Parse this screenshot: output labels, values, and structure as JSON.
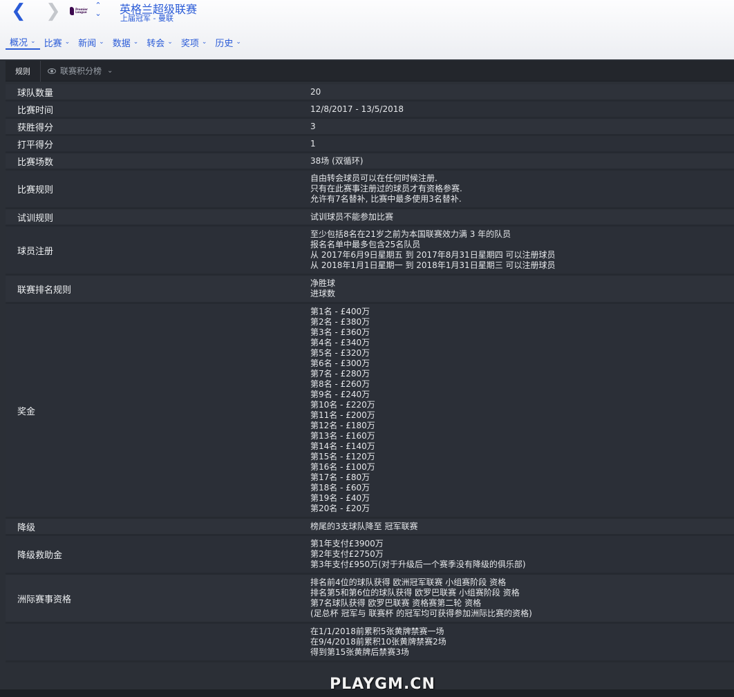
{
  "header": {
    "title": "英格兰超级联赛",
    "subtitle": "上届冠军 - 曼联",
    "logo_text": "Premier League",
    "back_icon": "chevron-left-icon",
    "forward_icon": "chevron-right-icon"
  },
  "tabs": [
    {
      "label": "概况"
    },
    {
      "label": "比赛"
    },
    {
      "label": "新闻"
    },
    {
      "label": "数据"
    },
    {
      "label": "转会"
    },
    {
      "label": "奖项"
    },
    {
      "label": "历史"
    }
  ],
  "toolbar": {
    "rules_label": "规则",
    "standings_label": "联赛积分榜"
  },
  "rows": [
    {
      "label": "球队数量",
      "lines": [
        "20"
      ]
    },
    {
      "label": "比赛时间",
      "lines": [
        "12/8/2017 - 13/5/2018"
      ]
    },
    {
      "label": "获胜得分",
      "lines": [
        "3"
      ]
    },
    {
      "label": "打平得分",
      "lines": [
        "1"
      ]
    },
    {
      "label": "比赛场数",
      "lines": [
        "38场 (双循环)"
      ]
    },
    {
      "label": "比赛规则",
      "lines": [
        "自由转会球员可以在任何时候注册.",
        "只有在此赛事注册过的球员才有资格参赛.",
        "允许有7名替补, 比赛中最多使用3名替补."
      ]
    },
    {
      "label": "试训规则",
      "lines": [
        "试训球员不能参加比赛"
      ]
    },
    {
      "label": "球员注册",
      "lines": [
        "至少包括8名在21岁之前为本国联赛效力满 3 年的队员",
        "报名名单中最多包含25名队员",
        "从 2017年6月9日星期五 到 2017年8月31日星期四 可以注册球员",
        "从 2018年1月1日星期一 到 2018年1月31日星期三 可以注册球员"
      ]
    },
    {
      "label": "联赛排名规则",
      "lines": [
        "净胜球",
        "进球数"
      ]
    },
    {
      "label": "奖金",
      "lines": [
        "第1名 - £400万",
        "第2名 - £380万",
        "第3名 - £360万",
        "第4名 - £340万",
        "第5名 - £320万",
        "第6名 - £300万",
        "第7名 - £280万",
        "第8名 - £260万",
        "第9名 - £240万",
        "第10名 - £220万",
        "第11名 - £200万",
        "第12名 - £180万",
        "第13名 - £160万",
        "第14名 - £140万",
        "第15名 - £120万",
        "第16名 - £100万",
        "第17名 - £80万",
        "第18名 - £60万",
        "第19名 - £40万",
        "第20名 - £20万"
      ]
    },
    {
      "label": "降级",
      "lines": [
        "榜尾的3支球队降至 冠军联赛"
      ]
    },
    {
      "label": "降级救助金",
      "lines": [
        "第1年支付£3900万",
        "第2年支付£2750万",
        "第3年支付£950万(对于升级后一个赛季没有降级的俱乐部)"
      ]
    },
    {
      "label": "洲际赛事资格",
      "lines": [
        "排名前4位的球队获得 欧洲冠军联赛 小组赛阶段 资格",
        "排名第5和第6位的球队获得 欧罗巴联赛 小组赛阶段 资格",
        "第7名球队获得 欧罗巴联赛 资格赛第二轮 资格",
        "(足总杯 冠军与 联赛杯 的冠军均可获得参加洲际比赛的资格)"
      ]
    },
    {
      "label": "",
      "lines": [
        "在1/1/2018前累积5张黄牌禁赛一场",
        "在9/4/2018前累积10张黄牌禁赛2场",
        "得到第15张黄牌后禁赛3场"
      ]
    }
  ],
  "watermark": "PLAYGM.CN"
}
